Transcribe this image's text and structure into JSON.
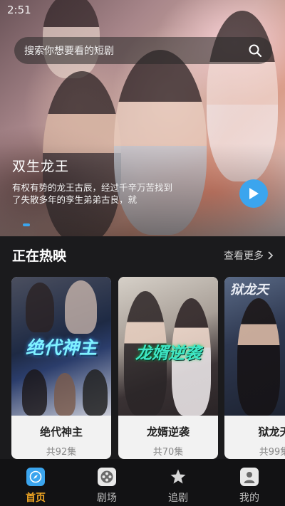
{
  "status_bar": {
    "time": "2:51"
  },
  "search": {
    "placeholder": "搜索你想要看的短剧"
  },
  "banner": {
    "title": "双生龙王",
    "description": "有权有势的龙王古辰，经过千辛万苦找到了失散多年的孪生弟弟古良，就",
    "active_slide": 1
  },
  "section": {
    "title": "正在热映",
    "more_label": "查看更多"
  },
  "dramas": [
    {
      "name": "绝代神主",
      "episodes": "共92集",
      "poster_text": "绝代神主"
    },
    {
      "name": "龙婿逆袭",
      "episodes": "共70集",
      "poster_text": "龙婿逆袭"
    },
    {
      "name": "狱龙天",
      "episodes": "共99集",
      "poster_text": "狱龙天"
    }
  ],
  "tabs": [
    {
      "label": "首页",
      "icon": "compass-icon",
      "active": true
    },
    {
      "label": "剧场",
      "icon": "film-reel-icon",
      "active": false
    },
    {
      "label": "追剧",
      "icon": "star-icon",
      "active": false
    },
    {
      "label": "我的",
      "icon": "user-icon",
      "active": false
    }
  ],
  "colors": {
    "accent": "#3ba5ee",
    "active_tab": "#f0a623",
    "background": "#1b1b1d"
  }
}
